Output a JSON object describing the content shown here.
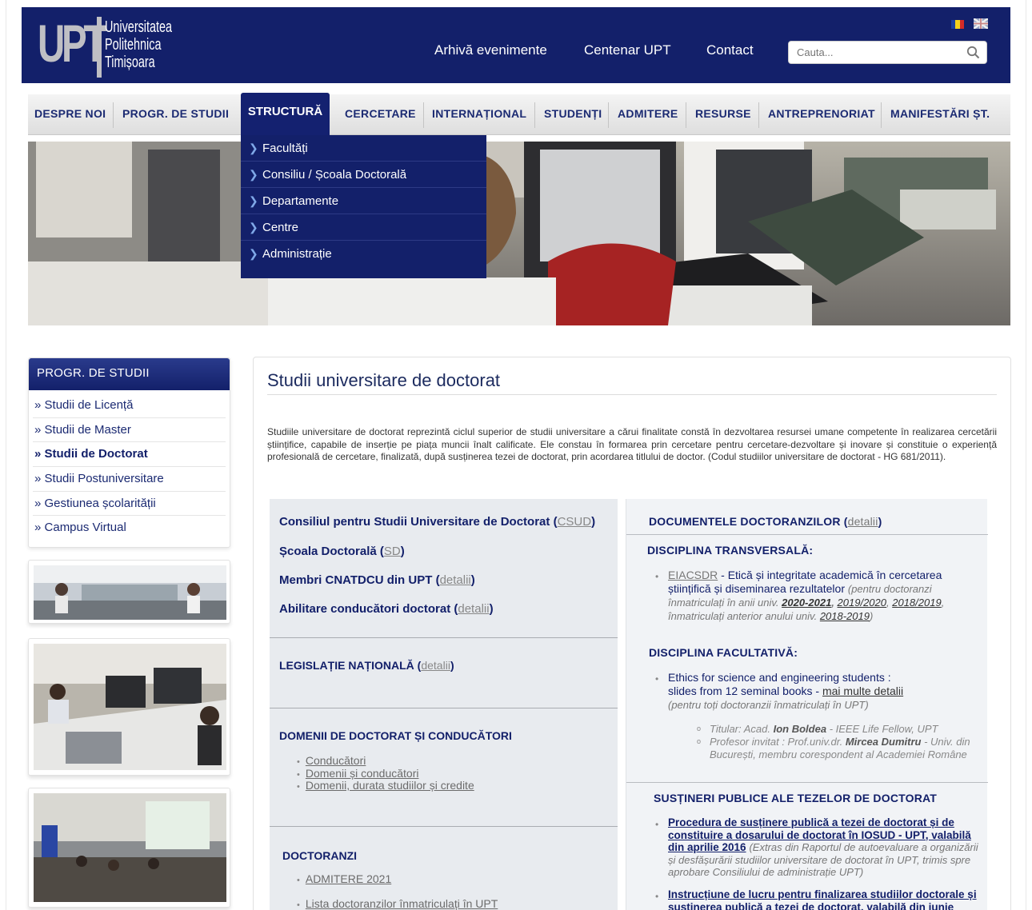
{
  "header": {
    "logo_mark": "UPT",
    "logo_lines": [
      "Universitatea",
      "Politehnica",
      "Timișoara"
    ],
    "links": [
      "Arhivă evenimente",
      "Centenar UPT",
      "Contact"
    ],
    "search_placeholder": "Cauta..."
  },
  "nav": {
    "items": [
      "DESPRE NOI",
      "PROGR. DE STUDII",
      "STRUCTURĂ",
      "CERCETARE",
      "INTERNAȚIONAL",
      "STUDENȚI",
      "ADMITERE",
      "RESURSE",
      "ANTREPRENORIAT",
      "MANIFESTĂRI ȘT."
    ],
    "active": "STRUCTURĂ"
  },
  "dropdown": {
    "items": [
      "Facultăți",
      "Consiliu / Școala Doctorală",
      "Departamente",
      "Centre",
      "Administrație"
    ]
  },
  "sidebar": {
    "title": "PROGR. DE STUDII",
    "links": [
      "Studii de Licență",
      "Studii de Master",
      "Studii de Doctorat",
      "Studii Postuniversitare",
      "Gestiunea școlarității",
      "Campus Virtual"
    ],
    "active": "Studii de Doctorat",
    "bullet": "»"
  },
  "main": {
    "title": "Studii universitare de doctorat",
    "intro": "Studiile universitare de doctorat reprezintă ciclul superior de studii universitare a cărui finalitate constă în dezvoltarea resursei umane competente în realizarea cercetării științifice, capabile de inserție pe piața muncii înalt calificate. Ele constau în formarea prin cercetare pentru cercetare-dezvoltare și inovare și constituie o experiență profesională de cercetare, finalizată, după susținerea tezei de doctorat, prin acordarea titlului de doctor. (Codul studiilor universitare de doctorat - HG 681/2011).",
    "left": {
      "csud": "Consiliul pentru Studii Universitare de Doctorat",
      "csud_link": "CSUD",
      "sd": "Școala Doctorală",
      "sd_link": "SD",
      "cnatdcu": "Membri CNATDCU din UPT",
      "cnatdcu_link": "detalii",
      "abilitare": "Abilitare conducători doctorat",
      "abilitare_link": "detalii",
      "legislatie": "LEGISLAȚIE NAȚIONALĂ",
      "legislatie_link": "detalii",
      "domenii": "DOMENII DE DOCTORAT ȘI CONDUCĂTORI",
      "domenii_links": [
        "Conducători",
        "Domenii și conducători",
        "Domenii, durata studiilor și credite"
      ],
      "doctoranzi": "DOCTORANZI",
      "doctoranzi_links": [
        "ADMITERE 2021",
        "Lista doctoranzilor înmatriculați în UPT"
      ]
    },
    "right": {
      "documente": "DOCUMENTELE DOCTORANZILOR",
      "documente_link": "detalii",
      "transversala": "DISCIPLINA TRANSVERSALĂ:",
      "eiacsdr": "EIACSDR",
      "eiacsdr_text": "Etică și integritate academică în cercetarea științifică și diseminarea rezultatelor",
      "eiacsdr_note": "(pentru doctoranzi înmatriculați în anii univ.",
      "eiacsdr_years": [
        "2020-2021",
        "2019/2020",
        "2018/2019"
      ],
      "eiacsdr_note2": "înmatriculați anterior anului univ.",
      "eiacsdr_year_old": "2018-2019",
      "facultativa": "DISCIPLINA FACULTATIVĂ:",
      "ethics": "Ethics for science and engineering students :",
      "ethics2": "slides from 12 seminal books -",
      "ethics_link": "mai multe detalii",
      "ethics_note": "(pentru toți doctoranzii înmatriculați în UPT)",
      "titular_label": "Titular: Acad.",
      "titular_name": "Ion Boldea",
      "titular_rest": "- IEEE Life Fellow, UPT",
      "invitat_label": "Profesor invitat : Prof.univ.dr.",
      "invitat_name": "Mircea Dumitru",
      "invitat_rest": "- Univ. din București, membru corespondent al Academiei Române",
      "sustineri": "SUSȚINERI PUBLICE ALE TEZELOR DE DOCTORAT",
      "procedura": "Procedura de susținere publică a tezei de doctorat și de constituire a dosarului de doctorat în IOSUD - UPT, valabilă din aprilie 2016",
      "procedura_note": "(Extras din Raportul de autoevaluare a organizării și desfășurării studiilor universitare de doctorat în UPT, trimis spre aprobare Consiliului de administrație UPT)",
      "instructiune": "Instrucțiune de lucru pentru finalizarea studiilor doctorale și susținerea publică a tezei de doctorat, valabilă din iunie"
    }
  },
  "colors": {
    "navy": "#13206a",
    "nav_text": "#1b2a72"
  }
}
